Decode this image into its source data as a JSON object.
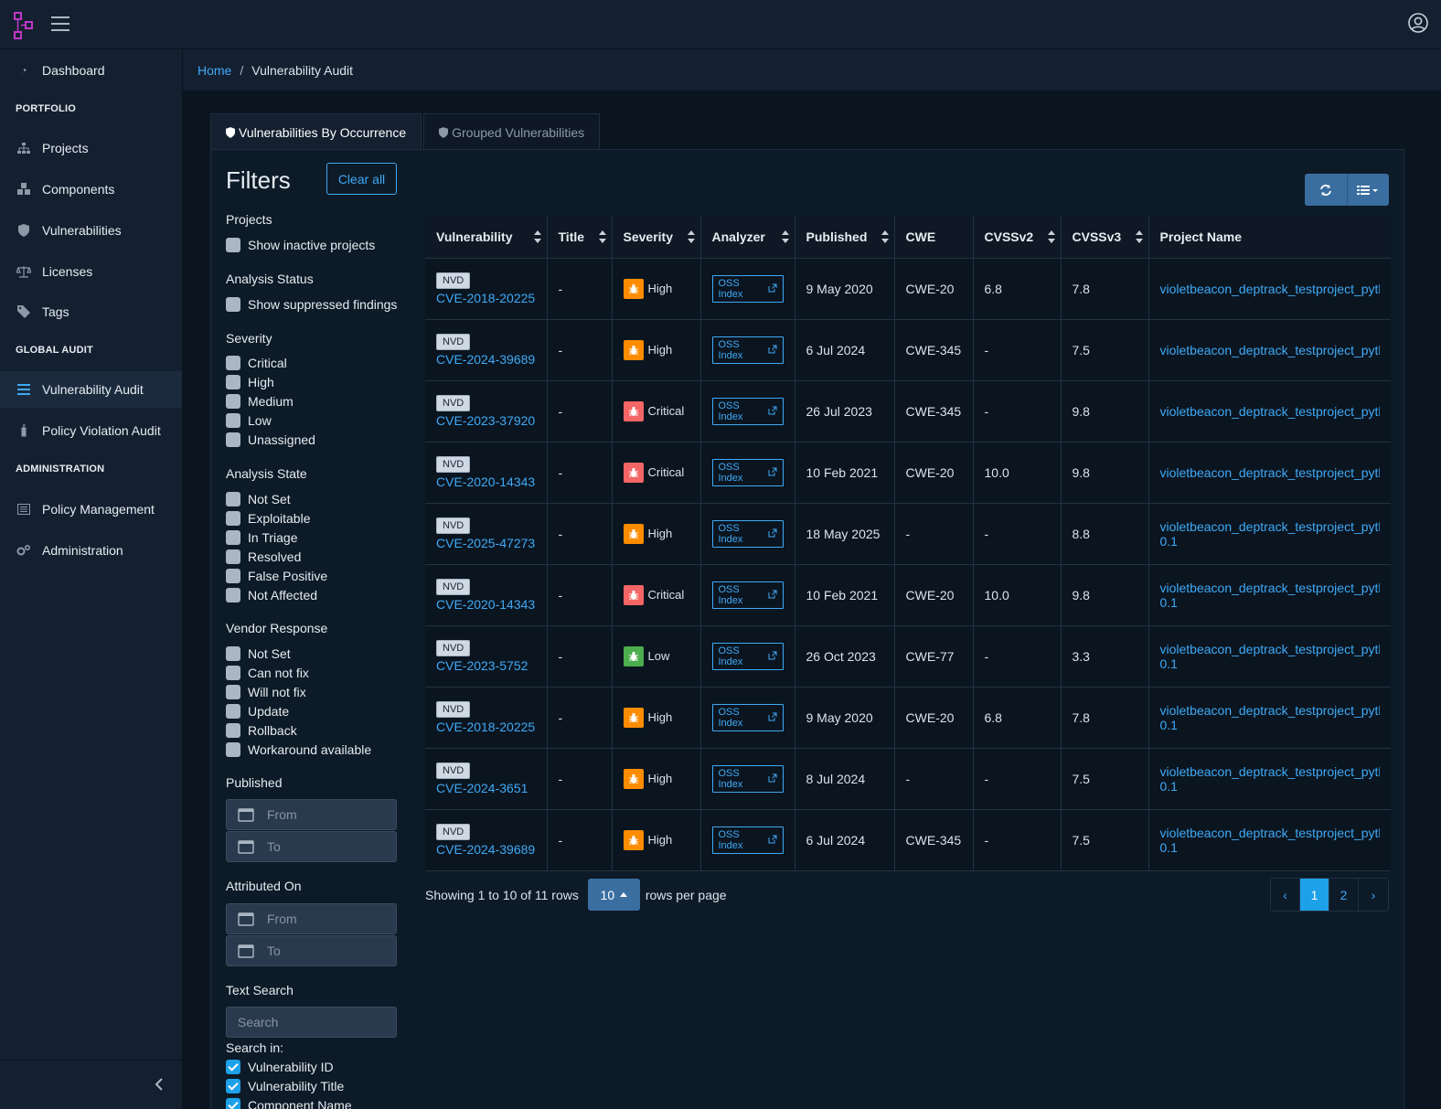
{
  "sidebar": {
    "dashboard": "Dashboard",
    "portfolio_heading": "PORTFOLIO",
    "projects": "Projects",
    "components": "Components",
    "vulnerabilities": "Vulnerabilities",
    "licenses": "Licenses",
    "tags": "Tags",
    "global_audit_heading": "GLOBAL AUDIT",
    "vulnerability_audit": "Vulnerability Audit",
    "policy_violation_audit": "Policy Violation Audit",
    "administration_heading": "ADMINISTRATION",
    "policy_management": "Policy Management",
    "administration": "Administration"
  },
  "breadcrumb": {
    "home": "Home",
    "current": "Vulnerability Audit"
  },
  "tabs": [
    {
      "label": "Vulnerabilities By Occurrence",
      "active": true
    },
    {
      "label": "Grouped Vulnerabilities",
      "active": false
    }
  ],
  "filters": {
    "title": "Filters",
    "clear_all": "Clear all",
    "projects_label": "Projects",
    "show_inactive": "Show inactive projects",
    "analysis_status_label": "Analysis Status",
    "show_suppressed": "Show suppressed findings",
    "severity_label": "Severity",
    "severity": [
      "Critical",
      "High",
      "Medium",
      "Low",
      "Unassigned"
    ],
    "analysis_state_label": "Analysis State",
    "analysis_state": [
      "Not Set",
      "Exploitable",
      "In Triage",
      "Resolved",
      "False Positive",
      "Not Affected"
    ],
    "vendor_response_label": "Vendor Response",
    "vendor_response": [
      "Not Set",
      "Can not fix",
      "Will not fix",
      "Update",
      "Rollback",
      "Workaround available"
    ],
    "published_label": "Published",
    "attributed_label": "Attributed On",
    "from_placeholder": "From",
    "to_placeholder": "To",
    "text_search_label": "Text Search",
    "search_placeholder": "Search",
    "search_in_label": "Search in:",
    "search_in": [
      "Vulnerability ID",
      "Vulnerability Title",
      "Component Name"
    ]
  },
  "table": {
    "columns": [
      "Vulnerability",
      "Title",
      "Severity",
      "Analyzer",
      "Published",
      "CWE",
      "CVSSv2",
      "CVSSv3",
      "Project Name"
    ],
    "rows": [
      {
        "source": "NVD",
        "id": "CVE-2018-20225",
        "title": "-",
        "severity": "High",
        "analyzer": "OSS Index",
        "published": "9 May 2020",
        "cwe": "CWE-20",
        "cvss2": "6.8",
        "cvss3": "7.8",
        "project": "violetbeacon_deptrack_testproject_pytho",
        "project_ver": ""
      },
      {
        "source": "NVD",
        "id": "CVE-2024-39689",
        "title": "-",
        "severity": "High",
        "analyzer": "OSS Index",
        "published": "6 Jul 2024",
        "cwe": "CWE-345",
        "cvss2": "-",
        "cvss3": "7.5",
        "project": "violetbeacon_deptrack_testproject_pytho",
        "project_ver": ""
      },
      {
        "source": "NVD",
        "id": "CVE-2023-37920",
        "title": "-",
        "severity": "Critical",
        "analyzer": "OSS Index",
        "published": "26 Jul 2023",
        "cwe": "CWE-345",
        "cvss2": "-",
        "cvss3": "9.8",
        "project": "violetbeacon_deptrack_testproject_pytho",
        "project_ver": ""
      },
      {
        "source": "NVD",
        "id": "CVE-2020-14343",
        "title": "-",
        "severity": "Critical",
        "analyzer": "OSS Index",
        "published": "10 Feb 2021",
        "cwe": "CWE-20",
        "cvss2": "10.0",
        "cvss3": "9.8",
        "project": "violetbeacon_deptrack_testproject_pytho",
        "project_ver": ""
      },
      {
        "source": "NVD",
        "id": "CVE-2025-47273",
        "title": "-",
        "severity": "High",
        "analyzer": "OSS Index",
        "published": "18 May 2025",
        "cwe": "-",
        "cvss2": "-",
        "cvss3": "8.8",
        "project": "violetbeacon_deptrack_testproject_pytho",
        "project_ver": "0.1"
      },
      {
        "source": "NVD",
        "id": "CVE-2020-14343",
        "title": "-",
        "severity": "Critical",
        "analyzer": "OSS Index",
        "published": "10 Feb 2021",
        "cwe": "CWE-20",
        "cvss2": "10.0",
        "cvss3": "9.8",
        "project": "violetbeacon_deptrack_testproject_pytho",
        "project_ver": "0.1"
      },
      {
        "source": "NVD",
        "id": "CVE-2023-5752",
        "title": "-",
        "severity": "Low",
        "analyzer": "OSS Index",
        "published": "26 Oct 2023",
        "cwe": "CWE-77",
        "cvss2": "-",
        "cvss3": "3.3",
        "project": "violetbeacon_deptrack_testproject_pytho",
        "project_ver": "0.1"
      },
      {
        "source": "NVD",
        "id": "CVE-2018-20225",
        "title": "-",
        "severity": "High",
        "analyzer": "OSS Index",
        "published": "9 May 2020",
        "cwe": "CWE-20",
        "cvss2": "6.8",
        "cvss3": "7.8",
        "project": "violetbeacon_deptrack_testproject_pytho",
        "project_ver": "0.1"
      },
      {
        "source": "NVD",
        "id": "CVE-2024-3651",
        "title": "-",
        "severity": "High",
        "analyzer": "OSS Index",
        "published": "8 Jul 2024",
        "cwe": "-",
        "cvss2": "-",
        "cvss3": "7.5",
        "project": "violetbeacon_deptrack_testproject_pytho",
        "project_ver": "0.1"
      },
      {
        "source": "NVD",
        "id": "CVE-2024-39689",
        "title": "-",
        "severity": "High",
        "analyzer": "OSS Index",
        "published": "6 Jul 2024",
        "cwe": "CWE-345",
        "cvss2": "-",
        "cvss3": "7.5",
        "project": "violetbeacon_deptrack_testproject_pytho",
        "project_ver": "0.1"
      }
    ]
  },
  "severity_colors": {
    "Critical": "#f46565",
    "High": "#fd8c00",
    "Low": "#4cae4c"
  },
  "pagination": {
    "showing": "Showing 1 to 10 of 11 rows",
    "rows_per_page_value": "10",
    "rows_per_page_label": "rows per page",
    "prev": "‹",
    "pages": [
      "1",
      "2"
    ],
    "next": "›",
    "current": "1"
  }
}
